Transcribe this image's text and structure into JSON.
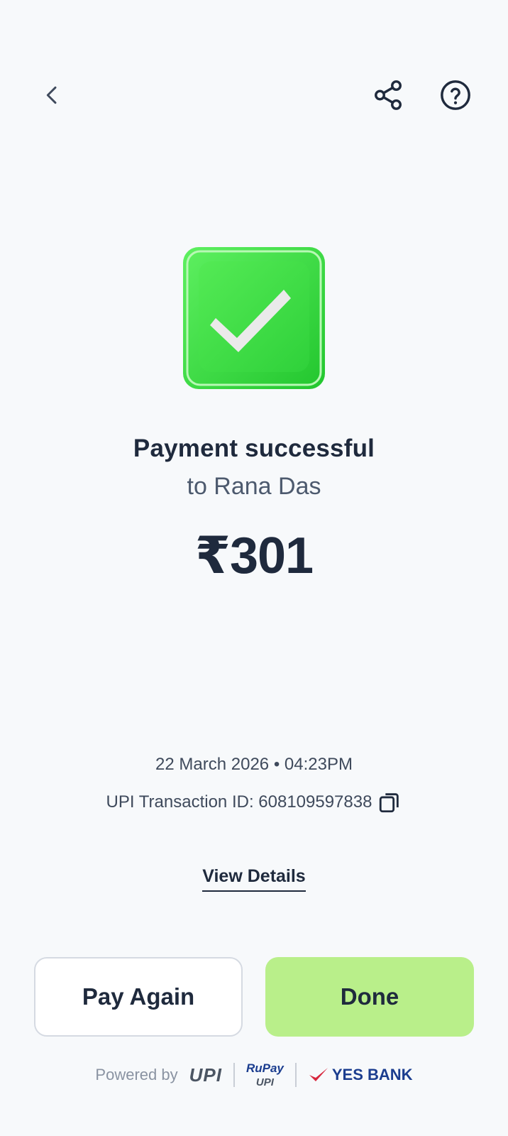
{
  "header": {
    "back_icon": "chevron-left-icon",
    "share_icon": "share-icon",
    "help_icon": "help-circle-icon"
  },
  "status": {
    "icon": "success-check-icon",
    "title": "Payment successful",
    "recipient": "to Rana Das",
    "amount": "₹301"
  },
  "transaction": {
    "datetime": "22 March 2026 • 04:23PM",
    "id_text": "UPI Transaction ID: 608109597838",
    "copy_icon": "copy-icon"
  },
  "links": {
    "view_details": "View Details"
  },
  "actions": {
    "pay_again": "Pay Again",
    "done": "Done"
  },
  "footer": {
    "powered_by": "Powered by",
    "upi": "UPI",
    "rupay_top": "RuPay",
    "rupay_bottom": "UPI",
    "bank": "YES BANK"
  },
  "colors": {
    "background": "#f7f9fb",
    "success_green": "#3fd94a",
    "done_button": "#b9ef8a",
    "text_primary": "#1f2a3d",
    "bank_blue": "#1b3d8f",
    "bank_red": "#d7263d"
  }
}
